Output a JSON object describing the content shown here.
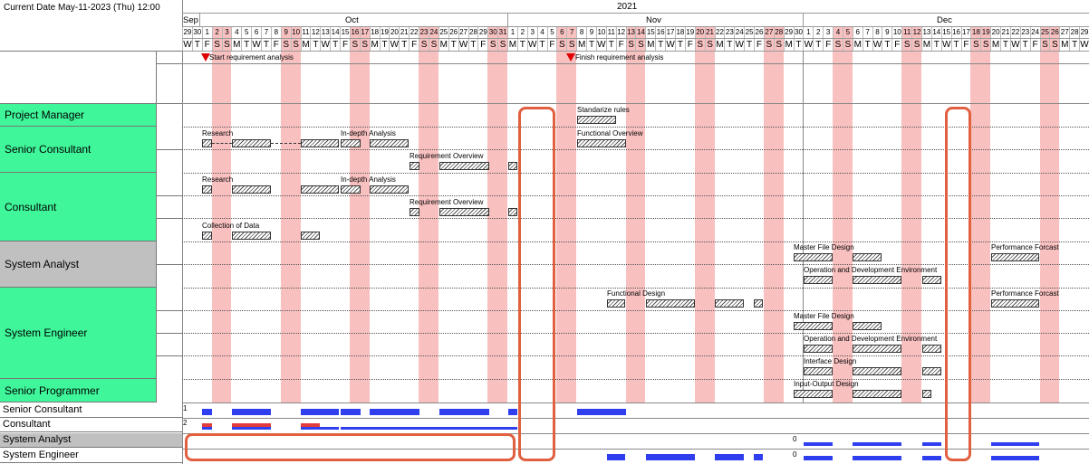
{
  "current_date": "Current Date May-11-2023 (Thu) 12:00",
  "year": "2021",
  "months": [
    {
      "label": "Sep"
    },
    {
      "label": "Oct"
    },
    {
      "label": "Nov"
    },
    {
      "label": "Dec"
    }
  ],
  "days": [
    "29",
    "30",
    "1",
    "2",
    "3",
    "4",
    "5",
    "6",
    "7",
    "8",
    "9",
    "10",
    "11",
    "12",
    "13",
    "14",
    "15",
    "16",
    "17",
    "18",
    "19",
    "20",
    "21",
    "22",
    "23",
    "24",
    "25",
    "26",
    "27",
    "28",
    "29",
    "30",
    "31",
    "1",
    "2",
    "3",
    "4",
    "5",
    "6",
    "7",
    "8",
    "9",
    "10",
    "11",
    "12",
    "13",
    "14",
    "15",
    "16",
    "17",
    "18",
    "19",
    "20",
    "21",
    "22",
    "23",
    "24",
    "25",
    "26",
    "27",
    "28",
    "29",
    "30",
    "1",
    "2",
    "3",
    "4",
    "5",
    "6",
    "7",
    "8",
    "9",
    "10",
    "11",
    "12",
    "13",
    "14",
    "15",
    "16",
    "17",
    "18",
    "19",
    "20",
    "21",
    "22",
    "23",
    "24",
    "25",
    "26",
    "27",
    "28",
    "29"
  ],
  "weekdays": [
    "W",
    "T",
    "F",
    "S",
    "S",
    "M",
    "T",
    "W",
    "T",
    "F",
    "S",
    "S",
    "M",
    "T",
    "W",
    "T",
    "F",
    "S",
    "S",
    "M",
    "T",
    "W",
    "T",
    "F",
    "S",
    "S",
    "M",
    "T",
    "W",
    "T",
    "F",
    "S",
    "S",
    "M",
    "T",
    "W",
    "T",
    "F",
    "S",
    "S",
    "M",
    "T",
    "W",
    "T",
    "F",
    "S",
    "S",
    "M",
    "T",
    "W",
    "T",
    "F",
    "S",
    "S",
    "M",
    "T",
    "W",
    "T",
    "F",
    "S",
    "S",
    "M",
    "T",
    "W",
    "T",
    "F",
    "S",
    "S",
    "M",
    "T",
    "W",
    "T",
    "F",
    "S",
    "S",
    "M",
    "T",
    "W",
    "T",
    "F",
    "S",
    "S",
    "M",
    "T",
    "W",
    "T",
    "F",
    "S",
    "S",
    "M",
    "T",
    "W"
  ],
  "milestones": [
    {
      "label": "Start requirement analysis"
    },
    {
      "label": "Finish requirement analysis"
    }
  ],
  "roles": [
    {
      "label": "Project Manager",
      "color": "#3ff79a"
    },
    {
      "label": "Senior Consultant",
      "color": "#3ff79a"
    },
    {
      "label": "Consultant",
      "color": "#3ff79a"
    },
    {
      "label": "System Analyst",
      "color": "#c0c0c0"
    },
    {
      "label": "System Engineer",
      "color": "#3ff79a"
    },
    {
      "label": "Senior Programmer",
      "color": "#3ff79a"
    }
  ],
  "resources": [
    {
      "label": "Senior Consultant",
      "color": "#ffffff"
    },
    {
      "label": "Consultant",
      "color": "#ffffff"
    },
    {
      "label": "System Analyst",
      "color": "#c0c0c0"
    },
    {
      "label": "System Engineer",
      "color": "#ffffff"
    }
  ],
  "tasks": {
    "standardize_rules": "Standarize rules",
    "sc_research": "Research",
    "sc_indepth": "In-depth Analysis",
    "sc_functional_overview": "Functional Overview",
    "sc_requirement_overview": "Requirement Overview",
    "c_research": "Research",
    "c_indepth": "In-depth Analysis",
    "c_requirement_overview": "Requirement Overview",
    "c_collection": "Collection of Data",
    "sa_master_file": "Master File Design",
    "sa_performance": "Performance Forcast",
    "sa_operation": "Operation and Development Environment",
    "se_functional": "Functional Design",
    "se_performance": "Performance Forcast",
    "se_master_file": "Master File Design",
    "se_operation": "Operation and Development Environment",
    "se_interface": "Interface Design",
    "sp_io": "Input-Output Design"
  },
  "resource_numbers": {
    "one": "1",
    "two": "2",
    "zero": "0"
  },
  "colors": {
    "role_green": "#3ff79a",
    "weekend_pink": "#f9c0c0",
    "usage_blue": "#2f3ff0",
    "overload_red": "#e23b3b",
    "highlight_orange": "#e06040",
    "milestone_red": "#e00000"
  }
}
